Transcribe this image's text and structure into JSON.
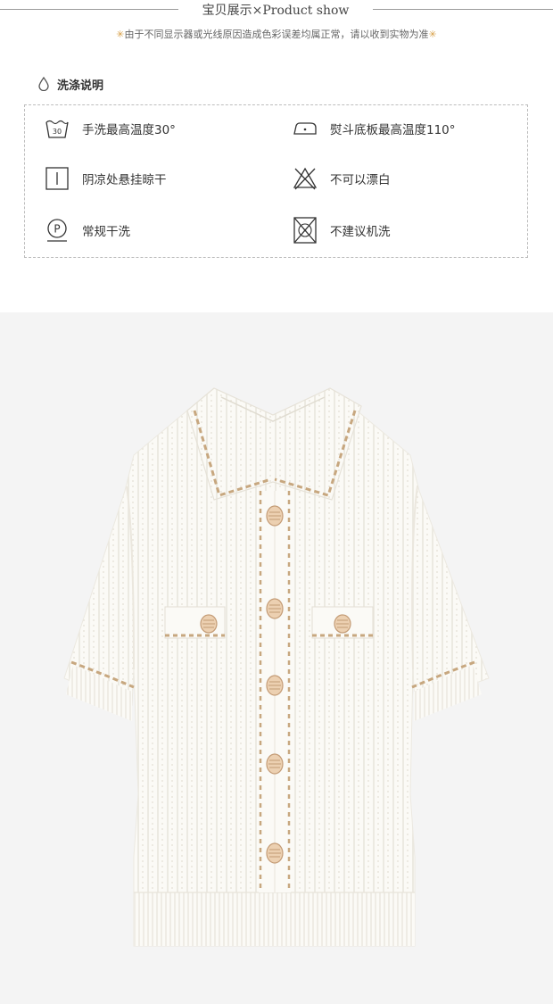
{
  "header": {
    "title": "宝贝展示×Product show"
  },
  "notice": {
    "star": "✳",
    "text": "由于不同显示器或光线原因造成色彩误差均属正常，请以收到实物为准",
    "star_end": "✳"
  },
  "care": {
    "heading": "洗涤说明",
    "items": [
      {
        "icon": "hand-wash-30-icon",
        "label": "手洗最高温度30°",
        "icon_text": "30"
      },
      {
        "icon": "iron-110-icon",
        "label": "熨斗底板最高温度110°"
      },
      {
        "icon": "line-dry-shade-icon",
        "label": "阴凉处悬挂晾干"
      },
      {
        "icon": "do-not-bleach-icon",
        "label": "不可以漂白"
      },
      {
        "icon": "dry-clean-icon",
        "label": "常规干洗",
        "icon_text": "P"
      },
      {
        "icon": "do-not-machine-wash-icon",
        "label": "不建议机洗"
      }
    ]
  },
  "product": {
    "image": "white-knit-cardigan-photo",
    "colors": {
      "background": "#f4f4f4",
      "knit": "#fbfaf6",
      "trim": "#c7a77f",
      "button": "#e8c9a8"
    }
  }
}
